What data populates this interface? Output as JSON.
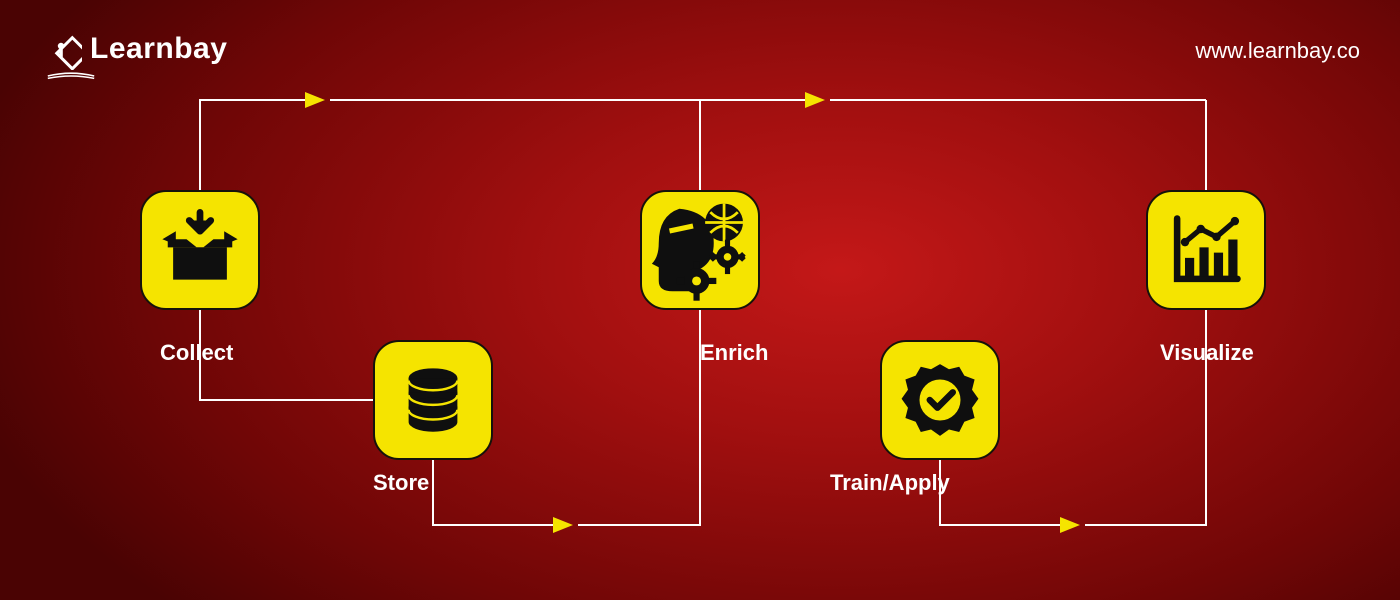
{
  "brand": {
    "name": "Learnbay",
    "url": "www.learnbay.co"
  },
  "colors": {
    "node_fill": "#f5e400",
    "node_stroke": "#15120a",
    "icon_fill": "#0f0f0f",
    "connector": "#ffffff",
    "arrow": "#f5e400",
    "text": "#ffffff"
  },
  "flow": {
    "steps": [
      {
        "id": "collect",
        "label": "Collect",
        "icon": "box-download-icon"
      },
      {
        "id": "store",
        "label": "Store",
        "icon": "database-icon"
      },
      {
        "id": "enrich",
        "label": "Enrich",
        "icon": "ai-globe-gear-icon"
      },
      {
        "id": "train",
        "label": "Train/Apply",
        "icon": "badge-check-icon"
      },
      {
        "id": "visualize",
        "label": "Visualize",
        "icon": "analytics-chart-icon"
      }
    ]
  }
}
